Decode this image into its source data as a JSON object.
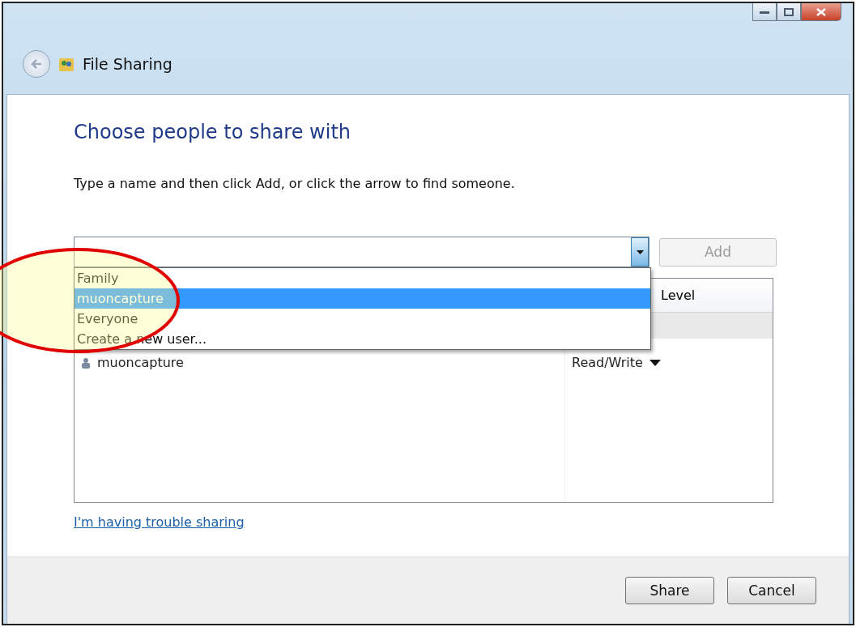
{
  "window": {
    "title": "File Sharing"
  },
  "heading": "Choose people to share with",
  "instructions": "Type a name and then click Add, or click the arrow to find someone.",
  "add_button": {
    "label": "Add",
    "disabled": true
  },
  "dropdown": {
    "open": true,
    "items": [
      {
        "label": "Family",
        "selected": false
      },
      {
        "label": "muoncapture",
        "selected": true
      },
      {
        "label": "Everyone",
        "selected": false
      },
      {
        "label": "Create a new user...",
        "selected": false
      }
    ]
  },
  "table": {
    "column_2_header": "Level",
    "rows": [
      {
        "name": "muoncapture",
        "permission": "Read/Write"
      }
    ]
  },
  "help_link": "I'm having trouble sharing",
  "buttons": [
    {
      "label": "Share"
    },
    {
      "label": "Cancel"
    }
  ]
}
